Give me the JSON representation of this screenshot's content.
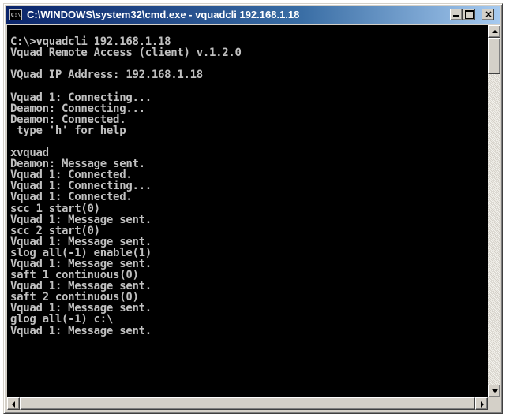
{
  "window": {
    "title": "C:\\WINDOWS\\system32\\cmd.exe - vquadcli 192.168.1.18",
    "icon_label": "C:\\",
    "icon": "console-icon",
    "controls": {
      "minimize": "minimize-icon",
      "maximize": "maximize-icon",
      "close": "×"
    }
  },
  "console": {
    "lines": [
      "",
      "C:\\>vquadcli 192.168.1.18",
      "Vquad Remote Access (client) v.1.2.0",
      "",
      "VQuad IP Address: 192.168.1.18",
      "",
      "Vquad 1: Connecting...",
      "Deamon: Connecting...",
      "Deamon: Connected.",
      " type 'h' for help",
      "",
      "xvquad",
      "Deamon: Message sent.",
      "Vquad 1: Connected.",
      "Vquad 1: Connecting...",
      "Vquad 1: Connected.",
      "scc 1 start(0)",
      "Vquad 1: Message sent.",
      "scc 2 start(0)",
      "Vquad 1: Message sent.",
      "slog all(-1) enable(1)",
      "Vquad 1: Message sent.",
      "saft 1 continuous(0)",
      "Vquad 1: Message sent.",
      "saft 2 continuous(0)",
      "Vquad 1: Message sent.",
      "glog all(-1) c:\\",
      "Vquad 1: Message sent.",
      "",
      "",
      "",
      ""
    ]
  },
  "colors": {
    "console_bg": "#000000",
    "console_fg": "#c0c0c0",
    "titlebar_start": "#0a246a",
    "titlebar_end": "#a6caf0"
  }
}
